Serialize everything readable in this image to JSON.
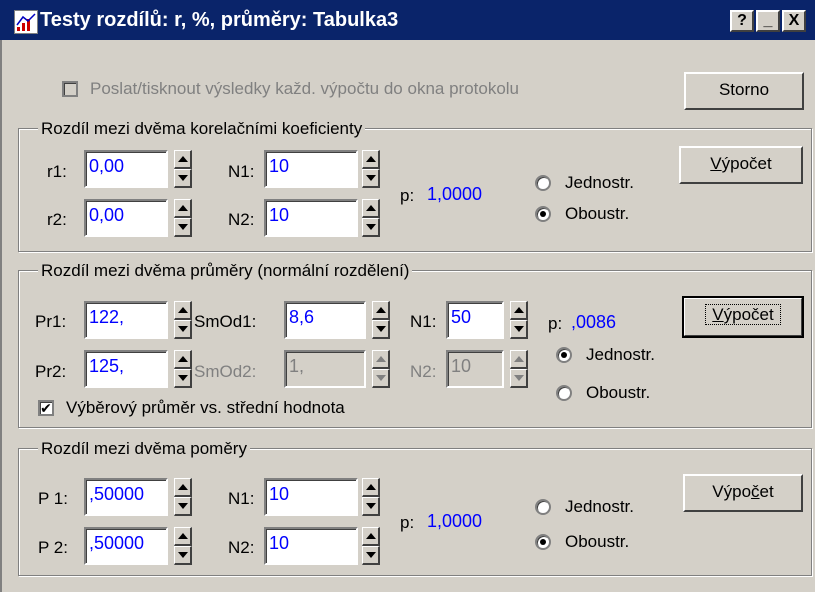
{
  "window": {
    "title": "Testy rozdílů: r, %, průměry: Tabulka3",
    "help_btn": "?",
    "min_btn": "_",
    "close_btn": "X"
  },
  "top": {
    "protocol_checkbox_label": "Poslat/tisknout výsledky každ. výpočtu do okna protokolu",
    "protocol_checked": false,
    "cancel_label": "Storno"
  },
  "correlation": {
    "group_label": "Rozdíl mezi dvěma korelačními koeficienty",
    "r1_label": "r1:",
    "r1_value": "0,00",
    "r2_label": "r2:",
    "r2_value": "0,00",
    "n1_label": "N1:",
    "n1_value": "10",
    "n2_label": "N2:",
    "n2_value": "10",
    "p_label": "p:",
    "p_value": "1,0000",
    "one_sided": "Jednostr.",
    "two_sided": "Oboustr.",
    "selected": "Oboustr.",
    "compute_label": "Výpočet"
  },
  "means": {
    "group_label": "Rozdíl mezi dvěma průměry (normální rozdělení)",
    "pr1_label": "Pr1:",
    "pr1_value": "122,",
    "pr2_label": "Pr2:",
    "pr2_value": "125,",
    "smod1_label": "SmOd1:",
    "smod1_value": "8,6",
    "smod2_label": "SmOd2:",
    "smod2_value": "1,",
    "n1_label": "N1:",
    "n1_value": "50",
    "n2_label": "N2:",
    "n2_value": "10",
    "p_label": "p:",
    "p_value": ",0086",
    "one_sided": "Jednostr.",
    "two_sided": "Oboustr.",
    "selected": "Jednostr.",
    "sample_vs_mean_label": "Výběrový průměr vs. střední hodnota",
    "sample_vs_mean_checked": true,
    "compute_label": "Výpočet"
  },
  "ratios": {
    "group_label": "Rozdíl mezi dvěma poměry",
    "p1_label": "P 1:",
    "p1_value": ",50000",
    "p2_label": "P 2:",
    "p2_value": ",50000",
    "n1_label": "N1:",
    "n1_value": "10",
    "n2_label": "N2:",
    "n2_value": "10",
    "p_label": "p:",
    "p_value": "1,0000",
    "one_sided": "Jednostr.",
    "two_sided": "Oboustr.",
    "selected": "Oboustr.",
    "compute_label": "Výpočet"
  },
  "colors": {
    "titlebar": "#0a246a",
    "value_text": "#0000ff",
    "face": "#d4d0c8"
  }
}
